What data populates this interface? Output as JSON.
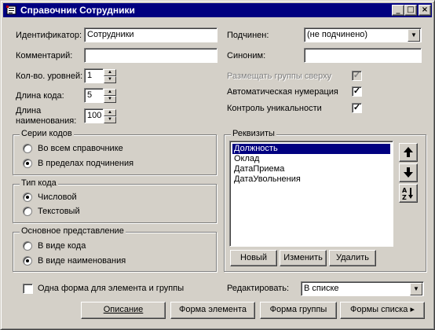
{
  "window": {
    "title": "Справочник Сотрудники",
    "minimize": "_",
    "maximize": "□",
    "close": "×"
  },
  "icons": {
    "app": "catalog-icon",
    "up": "arrow-up-icon",
    "down": "arrow-down-icon",
    "sort": "sort-az-icon"
  },
  "fields": {
    "identifier_label": "Идентификатор:",
    "identifier_value": "Сотрудники",
    "comment_label": "Комментарий:",
    "comment_value": "",
    "levels_label": "Кол-во. уровней:",
    "levels_value": "1",
    "code_length_label": "Длина кода:",
    "code_length_value": "5",
    "name_length_label_1": "Длина",
    "name_length_label_2": "наименования:",
    "name_length_value": "100",
    "subordinate_label": "Подчинен:",
    "subordinate_value": "(не подчинено)",
    "synonym_label": "Синоним:",
    "synonym_value": ""
  },
  "options": {
    "groups_top_label": "Размещать группы сверху",
    "groups_top_checked": true,
    "groups_top_enabled": false,
    "auto_numbering_label": "Автоматическая нумерация",
    "auto_numbering_checked": true,
    "uniqueness_label": "Контроль уникальности",
    "uniqueness_checked": true
  },
  "code_series": {
    "title": "Серии кодов",
    "options": [
      "Во всем справочнике",
      "В пределах подчинения"
    ],
    "selected": 1
  },
  "code_type": {
    "title": "Тип кода",
    "options": [
      "Числовой",
      "Текстовый"
    ],
    "selected": 0
  },
  "main_view": {
    "title": "Основное представление",
    "options": [
      "В виде кода",
      "В виде наименования"
    ],
    "selected": 1
  },
  "attributes": {
    "title": "Реквизиты",
    "items": [
      "Должность",
      "Оклад",
      "ДатаПриема",
      "ДатаУвольнения"
    ],
    "selected": 0,
    "new_button": "Новый",
    "edit_button": "Изменить",
    "delete_button": "Удалить"
  },
  "footer": {
    "one_form_label": "Одна форма для элемента и группы",
    "one_form_checked": false,
    "edit_label": "Редактировать:",
    "edit_value": "В списке",
    "description_button": "Описание",
    "element_form_button": "Форма элемента",
    "group_form_button": "Форма группы",
    "list_forms_button": "Формы списка"
  }
}
